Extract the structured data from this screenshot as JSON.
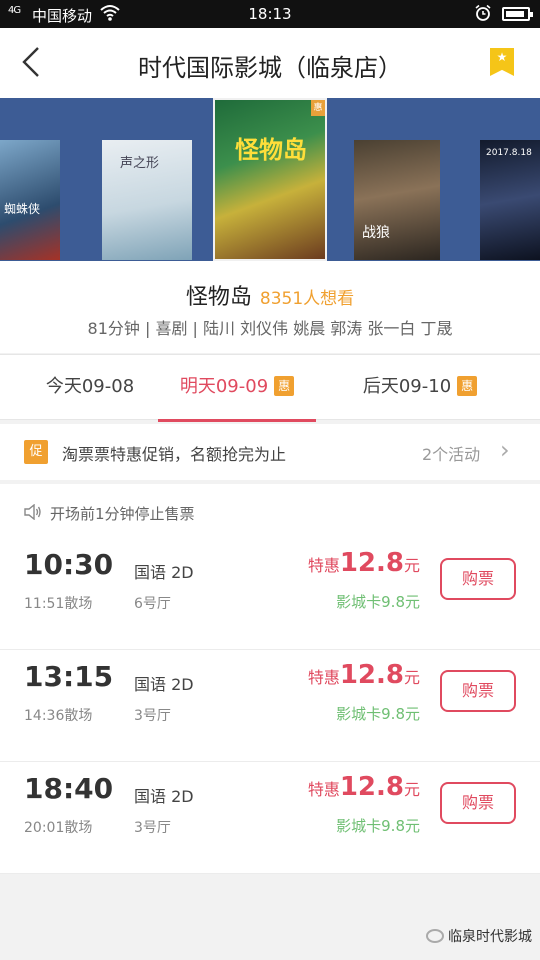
{
  "status_bar": {
    "signal": "4G",
    "carrier": "中国移动",
    "time": "18:13"
  },
  "header": {
    "title": "时代国际影城（临泉店）"
  },
  "posters": [
    {
      "text": "蜘蛛侠",
      "tag": ""
    },
    {
      "text": "声之形",
      "tag": ""
    },
    {
      "text": "怪物岛",
      "tag": "惠"
    },
    {
      "text": "战狼",
      "tag": ""
    },
    {
      "text": "2017.8.18",
      "tag": ""
    }
  ],
  "movie": {
    "title": "怪物岛",
    "want": "8351人想看",
    "meta": "81分钟 | 喜剧 | 陆川 刘仪伟 姚晨 郭涛 张一白 丁晟"
  },
  "tabs": [
    {
      "label": "今天09-08",
      "badge": ""
    },
    {
      "label": "明天09-09",
      "badge": "惠"
    },
    {
      "label": "后天09-10",
      "badge": "惠"
    }
  ],
  "promo": {
    "icon": "促",
    "text": "淘票票特惠促销，名额抢完为止",
    "count": "2个活动"
  },
  "notice": {
    "text": "开场前1分钟停止售票"
  },
  "showtimes": [
    {
      "start": "10:30",
      "end": "11:51散场",
      "lang": "国语 2D",
      "hall": "6号厅",
      "price_prefix": "特惠",
      "price": "12.8",
      "price_unit": "元",
      "card": "影城卡9.8元",
      "buy": "购票"
    },
    {
      "start": "13:15",
      "end": "14:36散场",
      "lang": "国语 2D",
      "hall": "3号厅",
      "price_prefix": "特惠",
      "price": "12.8",
      "price_unit": "元",
      "card": "影城卡9.8元",
      "buy": "购票"
    },
    {
      "start": "18:40",
      "end": "20:01散场",
      "lang": "国语 2D",
      "hall": "3号厅",
      "price_prefix": "特惠",
      "price": "12.8",
      "price_unit": "元",
      "card": "影城卡9.8元",
      "buy": "购票"
    }
  ],
  "watermark": "临泉时代影城",
  "colors": {
    "accent": "#e04a5f",
    "badge": "#f0a030",
    "card_price": "#6fbf73"
  }
}
